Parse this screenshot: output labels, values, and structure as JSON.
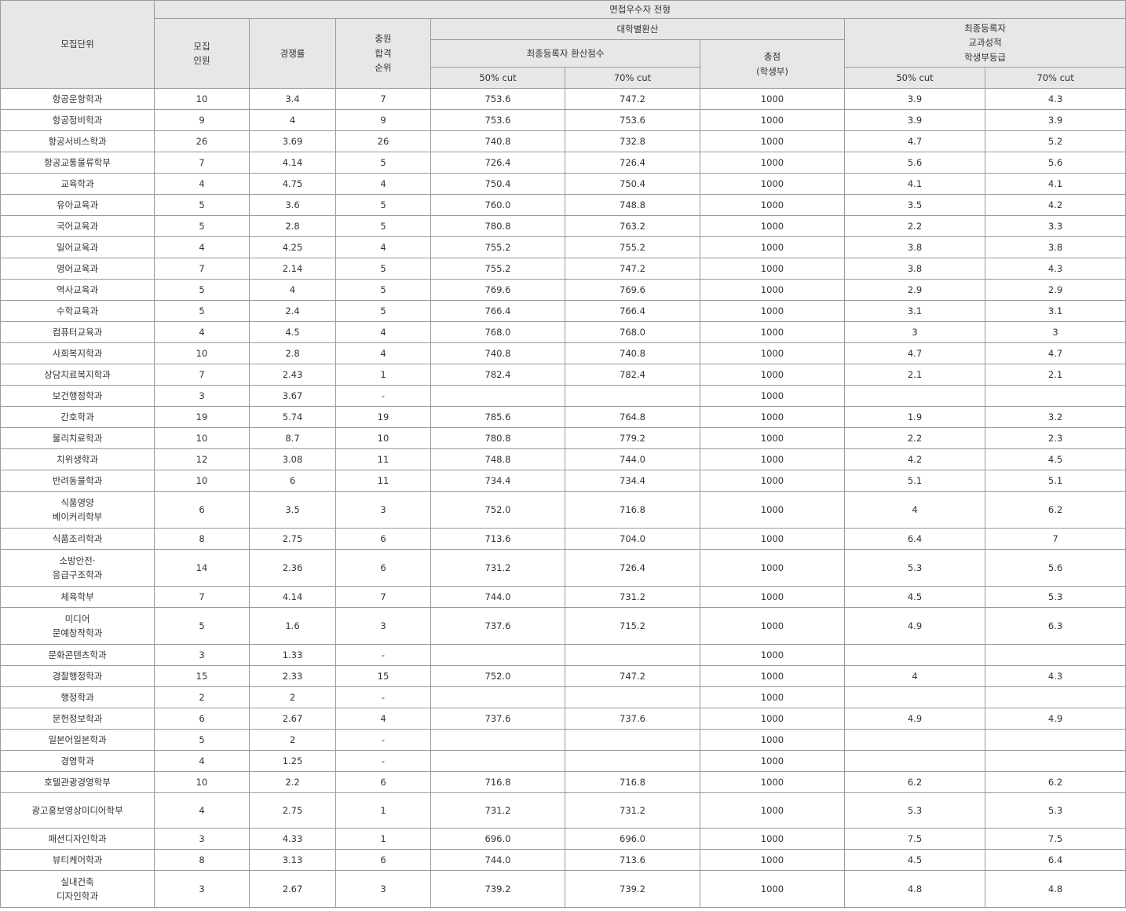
{
  "header": {
    "unit": "모집단위",
    "track": "면접우수자 전형",
    "quota": "모집\n인원",
    "rate": "경쟁률",
    "rank": "충원\n합격\n순위",
    "univ_calc": "대학별환산",
    "final_score": "최종등록자 환산점수",
    "total": "총점\n(학생부)",
    "final_grade": "최종등록자\n교과성적\n학생부등급",
    "cut50": "50% cut",
    "cut70": "70% cut",
    "grade_cut50": "50% cut",
    "grade_cut70": "70% cut"
  },
  "rows": [
    {
      "unit": "항공운항학과",
      "quota": "10",
      "rate": "3.4",
      "rank": "7",
      "s50": "753.6",
      "s70": "747.2",
      "total": "1000",
      "g50": "3.9",
      "g70": "4.3"
    },
    {
      "unit": "항공정비학과",
      "quota": "9",
      "rate": "4",
      "rank": "9",
      "s50": "753.6",
      "s70": "753.6",
      "total": "1000",
      "g50": "3.9",
      "g70": "3.9"
    },
    {
      "unit": "항공서비스학과",
      "quota": "26",
      "rate": "3.69",
      "rank": "26",
      "s50": "740.8",
      "s70": "732.8",
      "total": "1000",
      "g50": "4.7",
      "g70": "5.2"
    },
    {
      "unit": "항공교통물류학부",
      "quota": "7",
      "rate": "4.14",
      "rank": "5",
      "s50": "726.4",
      "s70": "726.4",
      "total": "1000",
      "g50": "5.6",
      "g70": "5.6"
    },
    {
      "unit": "교육학과",
      "quota": "4",
      "rate": "4.75",
      "rank": "4",
      "s50": "750.4",
      "s70": "750.4",
      "total": "1000",
      "g50": "4.1",
      "g70": "4.1"
    },
    {
      "unit": "유아교육과",
      "quota": "5",
      "rate": "3.6",
      "rank": "5",
      "s50": "760.0",
      "s70": "748.8",
      "total": "1000",
      "g50": "3.5",
      "g70": "4.2"
    },
    {
      "unit": "국어교육과",
      "quota": "5",
      "rate": "2.8",
      "rank": "5",
      "s50": "780.8",
      "s70": "763.2",
      "total": "1000",
      "g50": "2.2",
      "g70": "3.3"
    },
    {
      "unit": "일어교육과",
      "quota": "4",
      "rate": "4.25",
      "rank": "4",
      "s50": "755.2",
      "s70": "755.2",
      "total": "1000",
      "g50": "3.8",
      "g70": "3.8"
    },
    {
      "unit": "영어교육과",
      "quota": "7",
      "rate": "2.14",
      "rank": "5",
      "s50": "755.2",
      "s70": "747.2",
      "total": "1000",
      "g50": "3.8",
      "g70": "4.3"
    },
    {
      "unit": "역사교육과",
      "quota": "5",
      "rate": "4",
      "rank": "5",
      "s50": "769.6",
      "s70": "769.6",
      "total": "1000",
      "g50": "2.9",
      "g70": "2.9"
    },
    {
      "unit": "수학교육과",
      "quota": "5",
      "rate": "2.4",
      "rank": "5",
      "s50": "766.4",
      "s70": "766.4",
      "total": "1000",
      "g50": "3.1",
      "g70": "3.1"
    },
    {
      "unit": "컴퓨터교육과",
      "quota": "4",
      "rate": "4.5",
      "rank": "4",
      "s50": "768.0",
      "s70": "768.0",
      "total": "1000",
      "g50": "3",
      "g70": "3"
    },
    {
      "unit": "사회복지학과",
      "quota": "10",
      "rate": "2.8",
      "rank": "4",
      "s50": "740.8",
      "s70": "740.8",
      "total": "1000",
      "g50": "4.7",
      "g70": "4.7"
    },
    {
      "unit": "상담치료복지학과",
      "quota": "7",
      "rate": "2.43",
      "rank": "1",
      "s50": "782.4",
      "s70": "782.4",
      "total": "1000",
      "g50": "2.1",
      "g70": "2.1"
    },
    {
      "unit": "보건행정학과",
      "quota": "3",
      "rate": "3.67",
      "rank": "-",
      "s50": "",
      "s70": "",
      "total": "1000",
      "g50": "",
      "g70": ""
    },
    {
      "unit": "간호학과",
      "quota": "19",
      "rate": "5.74",
      "rank": "19",
      "s50": "785.6",
      "s70": "764.8",
      "total": "1000",
      "g50": "1.9",
      "g70": "3.2"
    },
    {
      "unit": "물리치료학과",
      "quota": "10",
      "rate": "8.7",
      "rank": "10",
      "s50": "780.8",
      "s70": "779.2",
      "total": "1000",
      "g50": "2.2",
      "g70": "2.3"
    },
    {
      "unit": "치위생학과",
      "quota": "12",
      "rate": "3.08",
      "rank": "11",
      "s50": "748.8",
      "s70": "744.0",
      "total": "1000",
      "g50": "4.2",
      "g70": "4.5"
    },
    {
      "unit": "반려동물학과",
      "quota": "10",
      "rate": "6",
      "rank": "11",
      "s50": "734.4",
      "s70": "734.4",
      "total": "1000",
      "g50": "5.1",
      "g70": "5.1"
    },
    {
      "unit": "식품영양\n베이커리학부",
      "quota": "6",
      "rate": "3.5",
      "rank": "3",
      "s50": "752.0",
      "s70": "716.8",
      "total": "1000",
      "g50": "4",
      "g70": "6.2"
    },
    {
      "unit": "식품조리학과",
      "quota": "8",
      "rate": "2.75",
      "rank": "6",
      "s50": "713.6",
      "s70": "704.0",
      "total": "1000",
      "g50": "6.4",
      "g70": "7"
    },
    {
      "unit": "소방안전·\n응급구조학과",
      "quota": "14",
      "rate": "2.36",
      "rank": "6",
      "s50": "731.2",
      "s70": "726.4",
      "total": "1000",
      "g50": "5.3",
      "g70": "5.6"
    },
    {
      "unit": "체육학부",
      "quota": "7",
      "rate": "4.14",
      "rank": "7",
      "s50": "744.0",
      "s70": "731.2",
      "total": "1000",
      "g50": "4.5",
      "g70": "5.3"
    },
    {
      "unit": "미디어\n문예창작학과",
      "quota": "5",
      "rate": "1.6",
      "rank": "3",
      "s50": "737.6",
      "s70": "715.2",
      "total": "1000",
      "g50": "4.9",
      "g70": "6.3"
    },
    {
      "unit": "문화콘텐츠학과",
      "quota": "3",
      "rate": "1.33",
      "rank": "-",
      "s50": "",
      "s70": "",
      "total": "1000",
      "g50": "",
      "g70": ""
    },
    {
      "unit": "경찰행정학과",
      "quota": "15",
      "rate": "2.33",
      "rank": "15",
      "s50": "752.0",
      "s70": "747.2",
      "total": "1000",
      "g50": "4",
      "g70": "4.3"
    },
    {
      "unit": "행정학과",
      "quota": "2",
      "rate": "2",
      "rank": "-",
      "s50": "",
      "s70": "",
      "total": "1000",
      "g50": "",
      "g70": ""
    },
    {
      "unit": "문헌정보학과",
      "quota": "6",
      "rate": "2.67",
      "rank": "4",
      "s50": "737.6",
      "s70": "737.6",
      "total": "1000",
      "g50": "4.9",
      "g70": "4.9"
    },
    {
      "unit": "일본어일본학과",
      "quota": "5",
      "rate": "2",
      "rank": "-",
      "s50": "",
      "s70": "",
      "total": "1000",
      "g50": "",
      "g70": ""
    },
    {
      "unit": "경영학과",
      "quota": "4",
      "rate": "1.25",
      "rank": "-",
      "s50": "",
      "s70": "",
      "total": "1000",
      "g50": "",
      "g70": ""
    },
    {
      "unit": "호텔관광경영학부",
      "quota": "10",
      "rate": "2.2",
      "rank": "6",
      "s50": "716.8",
      "s70": "716.8",
      "total": "1000",
      "g50": "6.2",
      "g70": "6.2"
    },
    {
      "unit": "광고홍보영상미디어학부",
      "quota": "4",
      "rate": "2.75",
      "rank": "1",
      "s50": "731.2",
      "s70": "731.2",
      "total": "1000",
      "g50": "5.3",
      "g70": "5.3"
    },
    {
      "unit": "패션디자인학과",
      "quota": "3",
      "rate": "4.33",
      "rank": "1",
      "s50": "696.0",
      "s70": "696.0",
      "total": "1000",
      "g50": "7.5",
      "g70": "7.5"
    },
    {
      "unit": "뷰티케어학과",
      "quota": "8",
      "rate": "3.13",
      "rank": "6",
      "s50": "744.0",
      "s70": "713.6",
      "total": "1000",
      "g50": "4.5",
      "g70": "6.4"
    },
    {
      "unit": "실내건축\n디자인학과",
      "quota": "3",
      "rate": "2.67",
      "rank": "3",
      "s50": "739.2",
      "s70": "739.2",
      "total": "1000",
      "g50": "4.8",
      "g70": "4.8"
    }
  ]
}
